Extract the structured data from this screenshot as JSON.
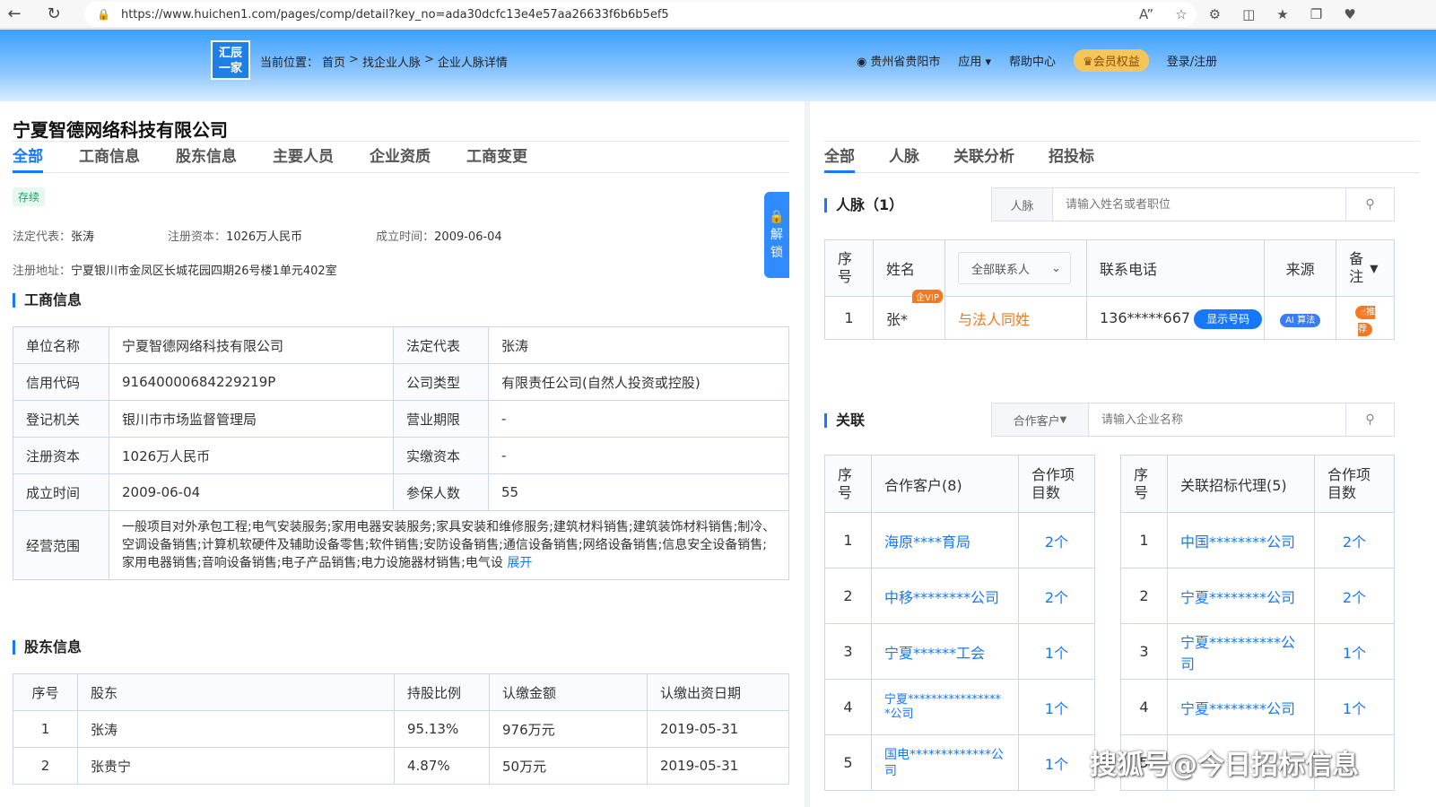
{
  "browser": {
    "url": "https://www.huichen1.com/pages/comp/detail?key_no=ada30dcfc13e4e57aa26633f6b6b5ef5"
  },
  "header": {
    "logo_line1": "汇辰",
    "logo_line2": "一家",
    "breadcrumb_label": "当前位置：",
    "breadcrumb": [
      "首页",
      "找企业人脉",
      "企业人脉详情"
    ],
    "location": "贵州省贵阳市",
    "apps": "应用",
    "help": "帮助中心",
    "vip": "会员权益",
    "login": "登录/注册"
  },
  "company": {
    "name": "宁夏智德网络科技有限公司",
    "tabs": [
      "全部",
      "工商信息",
      "股东信息",
      "主要人员",
      "企业资质",
      "工商变更"
    ],
    "status": "存续",
    "legal_rep_label": "法定代表：",
    "legal_rep": "张涛",
    "capital_label": "注册资本：",
    "capital": "1026万人民币",
    "founded_label": "成立时间：",
    "founded": "2009-06-04",
    "address_label": "注册地址：",
    "address": "宁夏银川市金凤区长城花园四期26号楼1单元402室"
  },
  "unlock": {
    "label": "解锁"
  },
  "business": {
    "title": "工商信息",
    "rows": [
      {
        "k1": "单位名称",
        "v1": "宁夏智德网络科技有限公司",
        "k2": "法定代表",
        "v2": "张涛"
      },
      {
        "k1": "信用代码",
        "v1": "91640000684229219P",
        "k2": "公司类型",
        "v2": "有限责任公司(自然人投资或控股)"
      },
      {
        "k1": "登记机关",
        "v1": "银川市市场监督管理局",
        "k2": "营业期限",
        "v2": "-"
      },
      {
        "k1": "注册资本",
        "v1": "1026万人民币",
        "k2": "实缴资本",
        "v2": "-"
      },
      {
        "k1": "成立时间",
        "v1": "2009-06-04",
        "k2": "参保人数",
        "v2": "55"
      }
    ],
    "scope_label": "经营范围",
    "scope_text": "一般项目对外承包工程;电气安装服务;家用电器安装服务;家具安装和维修服务;建筑材料销售;建筑装饰材料销售;制冷、空调设备销售;计算机软硬件及辅助设备零售;软件销售;安防设备销售;通信设备销售;网络设备销售;信息安全设备销售;家用电器销售;音响设备销售;电子产品销售;电力设施器材销售;电气设",
    "expand": "展开"
  },
  "shareholders": {
    "title": "股东信息",
    "headers": [
      "序号",
      "股东",
      "持股比例",
      "认缴金额",
      "认缴出资日期"
    ],
    "rows": [
      [
        "1",
        "张涛",
        "95.13%",
        "976万元",
        "2019-05-31"
      ],
      [
        "2",
        "张贵宁",
        "4.87%",
        "50万元",
        "2019-05-31"
      ]
    ]
  },
  "right": {
    "tabs": [
      "全部",
      "人脉",
      "关联分析",
      "招投标"
    ],
    "contacts_title": "人脉（1）",
    "contacts_search_prefix": "人脉",
    "contacts_search_placeholder": "请输入姓名或者职位",
    "contacts_headers": [
      "序号",
      "姓名",
      "全部联系人",
      "联系电话",
      "来源",
      "备注"
    ],
    "contact_row": {
      "no": "1",
      "name": "张*",
      "vip": "企VIP",
      "relation": "与法人同姓",
      "phone": "136*****667",
      "show_btn": "显示号码",
      "source": "算法",
      "remark": "推荐"
    },
    "relation_title": "关联",
    "relation_search_prefix": "合作客户",
    "relation_search_placeholder": "请输入企业名称",
    "clients": {
      "headers": [
        "序号",
        "合作客户(8)",
        "合作项目数"
      ],
      "rows": [
        [
          "1",
          "海原****育局",
          "2个"
        ],
        [
          "2",
          "中移********公司",
          "2个"
        ],
        [
          "3",
          "宁夏******工会",
          "1个"
        ],
        [
          "4",
          "宁夏*****************公司",
          "1个"
        ],
        [
          "5",
          "国电*************公司",
          "1个"
        ]
      ]
    },
    "agents": {
      "headers": [
        "序号",
        "关联招标代理(5)",
        "合作项目数"
      ],
      "rows": [
        [
          "1",
          "中国********公司",
          "2个"
        ],
        [
          "2",
          "宁夏********公司",
          "2个"
        ],
        [
          "3",
          "宁夏**********公司",
          "1个"
        ],
        [
          "4",
          "宁夏********公司",
          "1个"
        ],
        [
          "5",
          "",
          ""
        ]
      ]
    }
  },
  "watermark": "搜狐号@今日招标信息"
}
